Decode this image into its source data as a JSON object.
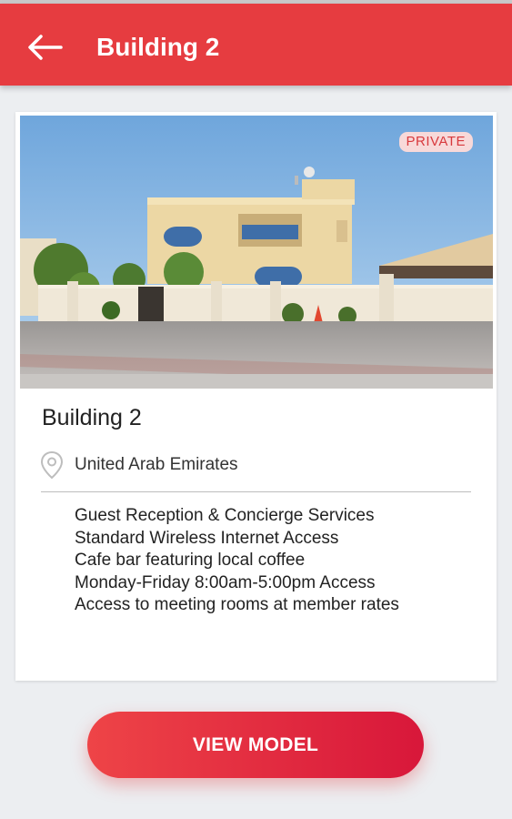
{
  "header": {
    "title": "Building 2",
    "back_icon": "arrow-left-icon",
    "background_color": "#e63c40"
  },
  "card": {
    "badge": "PRIVATE",
    "photo_icon": "building-photo",
    "title": "Building 2",
    "location_icon": "location-pin-icon",
    "location": "United Arab Emirates",
    "amenities": [
      "Guest Reception & Concierge Services",
      "Standard Wireless Internet Access",
      "Cafe bar featuring local coffee",
      "Monday-Friday 8:00am-5:00pm Access",
      "Access to meeting rooms at member rates"
    ]
  },
  "cta": {
    "label": "VIEW MODEL",
    "color_start": "#ee4447",
    "color_end": "#d8173a"
  }
}
